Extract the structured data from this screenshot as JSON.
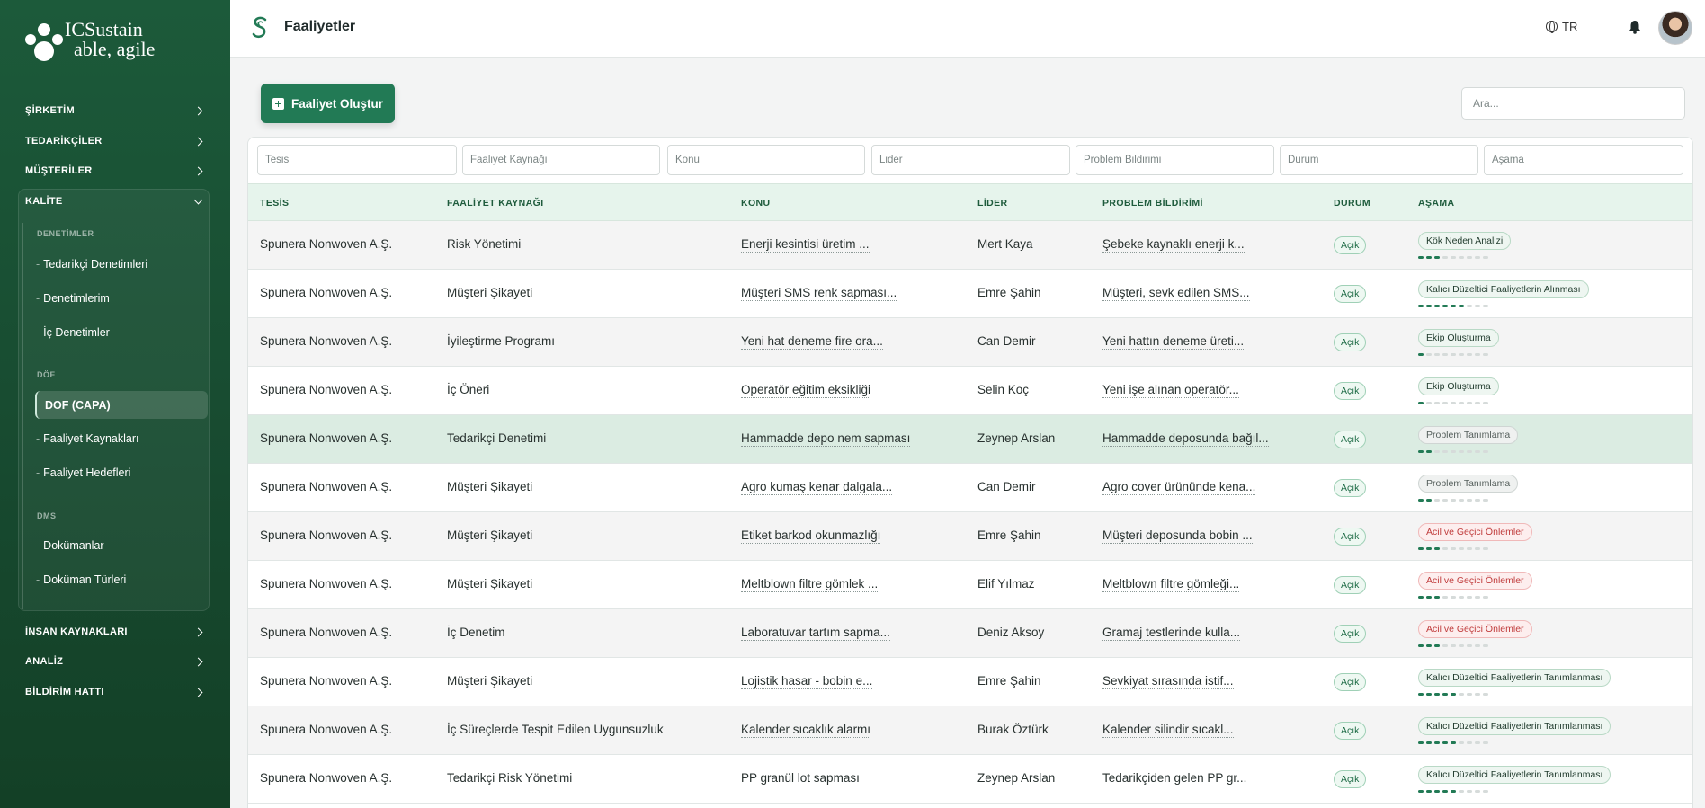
{
  "brand": {
    "line1": "ICSustain",
    "line2": "able, agile"
  },
  "sidebar": {
    "top_items": [
      {
        "label": "ŞİRKETİM"
      },
      {
        "label": "TEDARİKÇİLER"
      },
      {
        "label": "MÜŞTERİLER"
      },
      {
        "label": "KALİTE"
      }
    ],
    "kalite": {
      "groups": [
        {
          "label": "DENETİMLER",
          "items": [
            "Tedarikçi Denetimleri",
            "Denetimlerim",
            "İç Denetimler"
          ]
        },
        {
          "label": "DÖF",
          "items": [
            "DOF (CAPA)",
            "Faaliyet Kaynakları",
            "Faaliyet Hedefleri"
          ]
        },
        {
          "label": "DMS",
          "items": [
            "Dokümanlar",
            "Doküman Türleri"
          ]
        }
      ],
      "active_item": "DOF (CAPA)"
    },
    "bottom_items": [
      {
        "label": "İNSAN KAYNAKLARI"
      },
      {
        "label": "ANALİZ"
      },
      {
        "label": "BİLDİRİM HATTI"
      }
    ]
  },
  "header": {
    "title": "Faaliyetler",
    "language": "TR"
  },
  "toolbar": {
    "create_label": "Faaliyet Oluştur",
    "search_placeholder": "Ara..."
  },
  "filters": [
    "Tesis",
    "Faaliyet Kaynağı",
    "Konu",
    "Lider",
    "Problem Bildirimi",
    "Durum",
    "Aşama"
  ],
  "table": {
    "columns": [
      "TESİS",
      "FAALİYET KAYNAĞI",
      "KONU",
      "LİDER",
      "PROBLEM BİLDİRİMİ",
      "DURUM",
      "AŞAMA"
    ],
    "rows": [
      {
        "tesis": "Spunera Nonwoven A.Ş.",
        "kaynak": "Risk Yönetimi",
        "konu": "Enerji kesintisi üretim ...",
        "lider": "Mert Kaya",
        "problem": "Şebeke kaynaklı enerji k...",
        "durum": "Açık",
        "asama": "Kök Neden Analizi",
        "stage_color": "green",
        "progress": 3
      },
      {
        "tesis": "Spunera Nonwoven A.Ş.",
        "kaynak": "Müşteri Şikayeti",
        "konu": "Müşteri SMS renk sapması...",
        "lider": "Emre Şahin",
        "problem": "Müşteri, sevk edilen SMS...",
        "durum": "Açık",
        "asama": "Kalıcı Düzeltici Faaliyetlerin Alınması",
        "stage_color": "green",
        "progress": 6
      },
      {
        "tesis": "Spunera Nonwoven A.Ş.",
        "kaynak": "İyileştirme Programı",
        "konu": "Yeni hat deneme fire ora...",
        "lider": "Can Demir",
        "problem": "Yeni hattın deneme üreti...",
        "durum": "Açık",
        "asama": "Ekip Oluşturma",
        "stage_color": "green",
        "progress": 1
      },
      {
        "tesis": "Spunera Nonwoven A.Ş.",
        "kaynak": "İç Öneri",
        "konu": "Operatör eğitim eksikliği",
        "lider": "Selin Koç",
        "problem": "Yeni işe alınan operatör...",
        "durum": "Açık",
        "asama": "Ekip Oluşturma",
        "stage_color": "green",
        "progress": 1
      },
      {
        "tesis": "Spunera Nonwoven A.Ş.",
        "kaynak": "Tedarikçi Denetimi",
        "konu": "Hammadde depo nem sapması",
        "lider": "Zeynep Arslan",
        "problem": "Hammadde deposunda bağıl...",
        "durum": "Açık",
        "asama": "Problem Tanımlama",
        "stage_color": "gray",
        "progress": 2
      },
      {
        "tesis": "Spunera Nonwoven A.Ş.",
        "kaynak": "Müşteri Şikayeti",
        "konu": "Agro kumaş kenar dalgala...",
        "lider": "Can Demir",
        "problem": "Agro cover ürününde kena...",
        "durum": "Açık",
        "asama": "Problem Tanımlama",
        "stage_color": "gray",
        "progress": 2
      },
      {
        "tesis": "Spunera Nonwoven A.Ş.",
        "kaynak": "Müşteri Şikayeti",
        "konu": "Etiket barkod okunmazlığı",
        "lider": "Emre Şahin",
        "problem": "Müşteri deposunda bobin ...",
        "durum": "Açık",
        "asama": "Acil ve Geçici Önlemler",
        "stage_color": "red",
        "progress": 3
      },
      {
        "tesis": "Spunera Nonwoven A.Ş.",
        "kaynak": "Müşteri Şikayeti",
        "konu": "Meltblown filtre gömlek ...",
        "lider": "Elif Yılmaz",
        "problem": "Meltblown filtre gömleği...",
        "durum": "Açık",
        "asama": "Acil ve Geçici Önlemler",
        "stage_color": "red",
        "progress": 3
      },
      {
        "tesis": "Spunera Nonwoven A.Ş.",
        "kaynak": "İç Denetim",
        "konu": "Laboratuvar tartım sapma...",
        "lider": "Deniz Aksoy",
        "problem": "Gramaj testlerinde kulla...",
        "durum": "Açık",
        "asama": "Acil ve Geçici Önlemler",
        "stage_color": "red",
        "progress": 3
      },
      {
        "tesis": "Spunera Nonwoven A.Ş.",
        "kaynak": "Müşteri Şikayeti",
        "konu": "Lojistik hasar - bobin e...",
        "lider": "Emre Şahin",
        "problem": "Sevkiyat sırasında istif...",
        "durum": "Açık",
        "asama": "Kalıcı Düzeltici Faaliyetlerin Tanımlanması",
        "stage_color": "green",
        "progress": 5
      },
      {
        "tesis": "Spunera Nonwoven A.Ş.",
        "kaynak": "İç Süreçlerde Tespit Edilen Uygunsuzluk",
        "konu": "Kalender sıcaklık alarmı",
        "lider": "Burak Öztürk",
        "problem": "Kalender silindir sıcakl...",
        "durum": "Açık",
        "asama": "Kalıcı Düzeltici Faaliyetlerin Tanımlanması",
        "stage_color": "green",
        "progress": 5
      },
      {
        "tesis": "Spunera Nonwoven A.Ş.",
        "kaynak": "Tedarikçi Risk Yönetimi",
        "konu": "PP granül lot sapması",
        "lider": "Zeynep Arslan",
        "problem": "Tedarikçiden gelen PP gr...",
        "durum": "Açık",
        "asama": "Kalıcı Düzeltici Faaliyetlerin Tanımlanması",
        "stage_color": "green",
        "progress": 5
      }
    ],
    "highlight_row": 4,
    "progress_steps": 9
  },
  "colors": {
    "sidebar": "#17492f",
    "accent": "#227a55",
    "header_row": "#e6f4ec",
    "highlight": "#dbece2"
  }
}
